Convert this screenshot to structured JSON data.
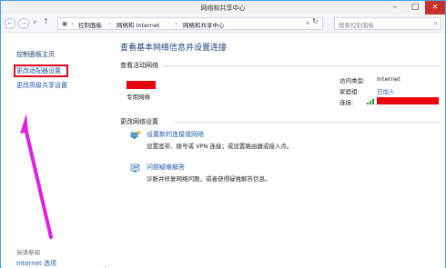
{
  "window": {
    "title": "网络和共享中心",
    "minimize_glyph": "–",
    "maximize_glyph": "□",
    "close_glyph": "✕"
  },
  "nav": {
    "back_glyph": "←",
    "forward_glyph": "→",
    "recent_glyph": "∨",
    "up_glyph": "↑",
    "breadcrumb": [
      "控制面板",
      "网络和 Internet",
      "网络和共享中心"
    ],
    "separator": "›",
    "dropdown_glyph": "∨",
    "refresh_glyph": "↻",
    "search_placeholder": "搜索控制面板",
    "search_glyph": "⌕"
  },
  "sidebar": {
    "home": "控制面板主页",
    "items": [
      {
        "label": "更改适配器设置"
      },
      {
        "label": "更改高级共享设置"
      }
    ],
    "see_also": "另请参阅",
    "see_also_items": [
      {
        "label": "Internet 选项"
      }
    ]
  },
  "main": {
    "heading": "查看基本网络信息并设置连接",
    "active_networks": "查看活动网络",
    "network_type": "专用网络",
    "access_type_label": "访问类型:",
    "access_type_value": "Internet",
    "homegroup_label": "家庭组:",
    "homegroup_value": "已加入",
    "connections_label": "连接:",
    "change_settings": "更改网络设置",
    "actions": [
      {
        "title": "设置新的连接或网络",
        "desc": "设置宽带、拨号或 VPN 连接；或设置路由器或接入点。"
      },
      {
        "title": "问题疑难解答",
        "desc": "诊断并修复网络问题，或者获得疑难解答信息。"
      }
    ]
  },
  "colors": {
    "link": "#1e5aa8",
    "highlight": "#e3001b",
    "arrow": "#e020e0",
    "redaction": "#e8000f"
  }
}
